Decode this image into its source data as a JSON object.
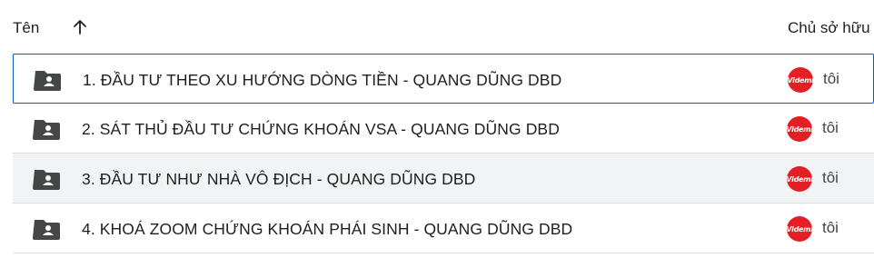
{
  "header": {
    "name_label": "Tên",
    "sort_icon": "arrow-up-icon",
    "owner_label": "Chủ sở hữu"
  },
  "rows": [
    {
      "name": "1. ĐẦU TƯ THEO XU HƯỚNG DÒNG TIỀN - QUANG DŨNG DBD",
      "owner": "tôi",
      "avatar_text": "Videmi",
      "icon": "shared-folder-icon",
      "state": "selected"
    },
    {
      "name": "2. SÁT THỦ ĐẦU TƯ CHỨNG KHOÁN VSA - QUANG DŨNG DBD",
      "owner": "tôi",
      "avatar_text": "Videmi",
      "icon": "shared-folder-icon",
      "state": "normal"
    },
    {
      "name": "3. ĐẦU TƯ NHƯ NHÀ VÔ ĐỊCH - QUANG DŨNG DBD",
      "owner": "tôi",
      "avatar_text": "Videmi",
      "icon": "shared-folder-icon",
      "state": "hover"
    },
    {
      "name": "4. KHOÁ ZOOM CHỨNG KHOÁN PHÁI SINH - QUANG DŨNG DBD",
      "owner": "tôi",
      "avatar_text": "Videmi",
      "icon": "shared-folder-icon",
      "state": "normal"
    }
  ],
  "colors": {
    "selected_border": "#0b57d0",
    "hover_bg": "#f1f3f4",
    "avatar_bg": "#e31e24",
    "divider": "#dadce0"
  }
}
